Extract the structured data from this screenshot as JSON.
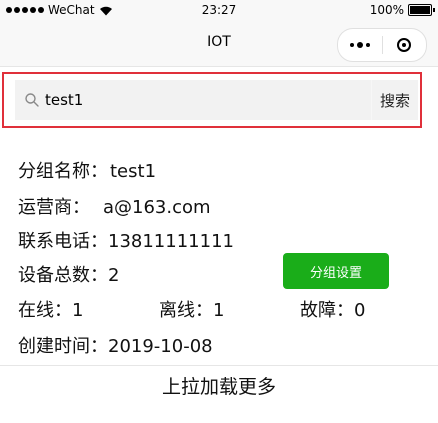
{
  "status_bar": {
    "carrier": "WeChat",
    "time": "23:27",
    "battery": "100%"
  },
  "nav": {
    "title": "IOT"
  },
  "search": {
    "value": "test1",
    "button_label": "搜索"
  },
  "group": {
    "name_label": "分组名称：",
    "name_value": "test1",
    "operator_label": "运营商：",
    "operator_value": "a@163.com",
    "phone_label": "联系电话：",
    "phone_value": "13811111111",
    "count_label": "设备总数：",
    "count_value": "2",
    "online_label": "在线：",
    "online_value": "1",
    "offline_label": "离线：",
    "offline_value": "1",
    "fault_label": "故障：",
    "fault_value": "0",
    "created_label": "创建时间：",
    "created_value": "2019-10-08",
    "settings_button": "分组设置"
  },
  "footer": {
    "load_more": "上拉加载更多"
  },
  "colors": {
    "accent_green": "#1aad19",
    "highlight_red": "#e0303a"
  }
}
